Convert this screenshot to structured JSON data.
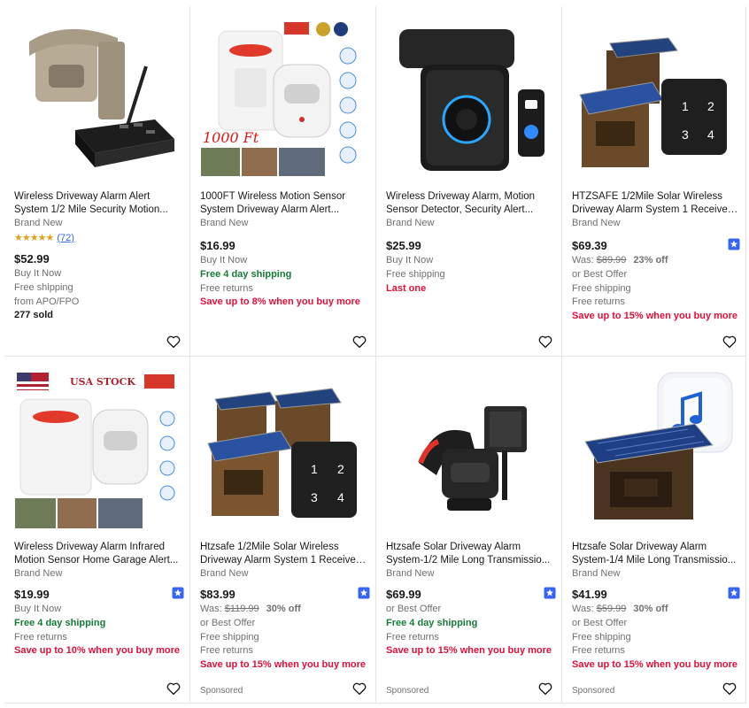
{
  "listings": [
    {
      "title": "Wireless Driveway Alarm Alert System 1/2 Mile Security Motion...",
      "condition": "Brand New",
      "rating_stars": "★★★★★",
      "rating_value": 4.5,
      "review_count": "(72)",
      "price": "$52.99",
      "lines": [
        "Buy It Now",
        "Free shipping",
        "from APO/FPO",
        "277 sold"
      ],
      "watch_icon": "heart-icon"
    },
    {
      "title": "1000FT Wireless Motion Sensor System Driveway Alarm Alert...",
      "condition": "Brand New",
      "price": "$16.99",
      "lines": [
        "Buy It Now",
        "Free 4 day shipping",
        "Free returns",
        "Save up to 8% when you buy more"
      ],
      "image_text": "1000 Ft",
      "watch_icon": "heart-icon"
    },
    {
      "title": "Wireless Driveway Alarm, Motion Sensor Detector, Security Alert...",
      "condition": "Brand New",
      "price": "$25.99",
      "lines": [
        "Buy It Now",
        "Free shipping",
        "Last one"
      ],
      "watch_icon": "heart-icon"
    },
    {
      "title": "HTZSAFE 1/2Mile Solar Wireless Driveway Alarm System 1 Receiver ...",
      "condition": "Brand New",
      "price": "$69.39",
      "was_label": "Was: ",
      "was_price": "$89.99",
      "discount": "23% off",
      "lines": [
        "or Best Offer",
        "Free shipping",
        "Free returns",
        "Save up to 15% when you buy more"
      ],
      "keypad": [
        "1",
        "2",
        "3",
        "4"
      ],
      "watch_icon": "heart-icon",
      "badge_icon": "authenticity-badge-icon"
    },
    {
      "title": "Wireless Driveway Alarm Infrared Motion Sensor Home Garage Alert...",
      "condition": "Brand New",
      "price": "$19.99",
      "lines": [
        "Buy It Now",
        "Free 4 day shipping",
        "Free returns",
        "Save up to 10% when you buy more"
      ],
      "image_text": "USA STOCK",
      "watch_icon": "heart-icon",
      "badge_icon": "authenticity-badge-icon"
    },
    {
      "title": "Htzsafe 1/2Mile Solar Wireless Driveway Alarm System 1 Receiver ...",
      "condition": "Brand New",
      "price": "$83.99",
      "was_label": "Was: ",
      "was_price": "$119.99",
      "discount": "30% off",
      "lines": [
        "or Best Offer",
        "Free shipping",
        "Free returns",
        "Save up to 15% when you buy more"
      ],
      "sponsored": "Sponsored",
      "keypad": [
        "1",
        "2",
        "3",
        "4"
      ],
      "watch_icon": "heart-icon",
      "badge_icon": "authenticity-badge-icon"
    },
    {
      "title": "Htzsafe Solar Driveway Alarm System-1/2 Mile Long Transmissio...",
      "condition": "Brand New",
      "price": "$69.99",
      "lines": [
        "or Best Offer",
        "Free 4 day shipping",
        "Free returns",
        "Save up to 15% when you buy more"
      ],
      "sponsored": "Sponsored",
      "watch_icon": "heart-icon",
      "badge_icon": "authenticity-badge-icon"
    },
    {
      "title": "Htzsafe Solar Driveway Alarm System-1/4 Mile Long Transmissio...",
      "condition": "Brand New",
      "price": "$41.99",
      "was_label": "Was: ",
      "was_price": "$59.99",
      "discount": "30% off",
      "lines": [
        "or Best Offer",
        "Free shipping",
        "Free returns",
        "Save up to 15% when you buy more"
      ],
      "sponsored": "Sponsored",
      "watch_icon": "heart-icon",
      "badge_icon": "authenticity-badge-icon"
    }
  ],
  "colors": {
    "link_blue": "#3665f3",
    "shipping_green": "#177b39",
    "promo_red": "#e0103a",
    "secondary_gray": "#707070",
    "star_gold": "#e4a11b",
    "badge_blue": "#3665f3"
  }
}
